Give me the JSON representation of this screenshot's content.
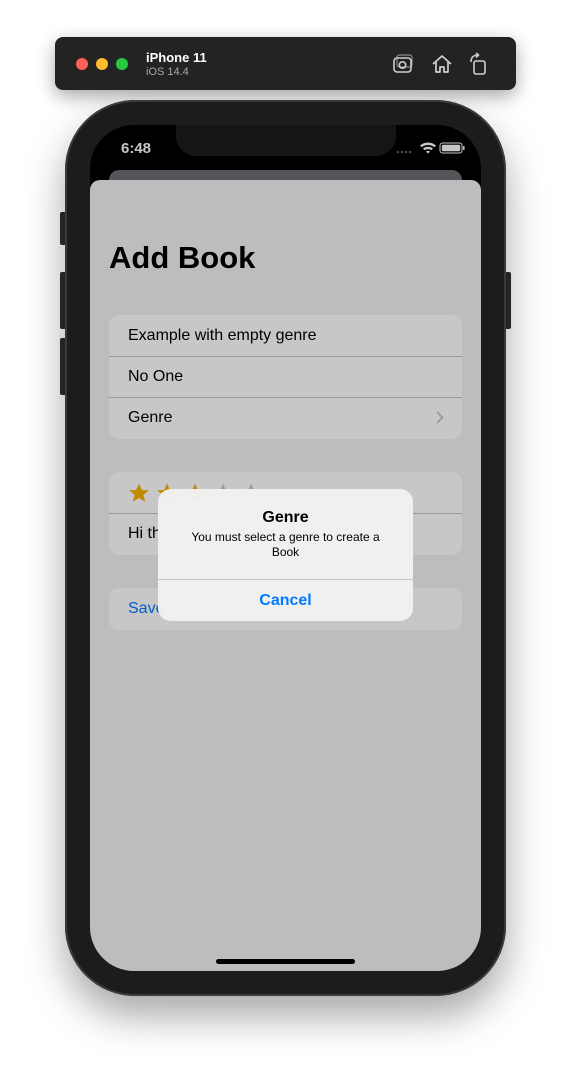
{
  "simulator": {
    "device_name": "iPhone 11",
    "os_version": "iOS 14.4",
    "icons": [
      "screenshot-icon",
      "home-icon",
      "rotate-icon"
    ]
  },
  "status_bar": {
    "time": "6:48",
    "icons": [
      "signal-icon",
      "wifi-icon",
      "battery-icon"
    ]
  },
  "page": {
    "title": "Add Book"
  },
  "form": {
    "book_title": "Example with empty genre",
    "author": "No One",
    "genre_label": "Genre",
    "rating_stars": 3,
    "rating_max": 5,
    "review": "Hi th",
    "save_label": "Save"
  },
  "alert": {
    "title": "Genre",
    "message": "You must select a genre to create a Book",
    "cancel_label": "Cancel"
  },
  "colors": {
    "accent": "#007aff",
    "star_filled": "#f5b301",
    "star_empty": "#c7c7cc",
    "background": "#f2f2f7"
  }
}
